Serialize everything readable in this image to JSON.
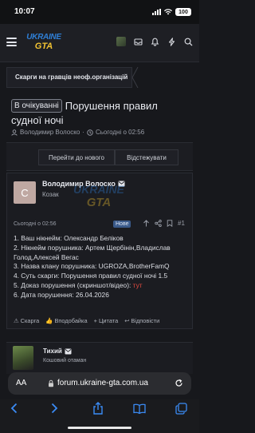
{
  "status": {
    "time": "10:07",
    "battery": "100"
  },
  "nav": {
    "logo_top": "UKRAINE",
    "logo_bottom": "GTA"
  },
  "breadcrumb": {
    "text": "Скарги на гравців неоф.організацій"
  },
  "thread": {
    "badge": "В очікуванні",
    "title_part1": "Порушення правил",
    "title_part2": "судної ночі",
    "author": "Володимир Волоско",
    "date": "Сьогодні о 02:56",
    "btn_new": "Перейти до нового",
    "btn_watch": "Відстежувати"
  },
  "post": {
    "avatar_letter": "С",
    "author": "Володимир Волоско",
    "role": "Козак",
    "date": "Сьогодні о 02:56",
    "new_badge": "Нове",
    "post_number": "#1",
    "watermark_top": "UKRAINE",
    "watermark_bottom": "GTA",
    "line1": "1. Ваш нікнейм: Олександр Беліков",
    "line2": "2. Нікнейм порушника: Артем Щербінін,Владислав Голод,Алексей Вегас",
    "line3": "3. Назва клану порушника: UGROZA,BrotherFamQ",
    "line4": "4. Суть скарги: Порушення правил судної ночі 1.5",
    "line5_prefix": "5. Доказ порушення (скриншот/відео):",
    "line5_link": "тут",
    "line6": "6. Дата порушення: 26.04.2026",
    "footer_report": "Скарга",
    "footer_like": "Вподобайка",
    "footer_quote": "+ Цитата",
    "footer_reply": "Відповісти"
  },
  "post2": {
    "author": "Тихий",
    "role": "Кошовий отаман"
  },
  "urlbar": {
    "aa": "AA",
    "url": "forum.ukraine-gta.com.ua"
  },
  "colors": {
    "background": "#17181c",
    "accent_blue": "#2f7fd6",
    "accent_yellow": "#f1c232",
    "link_red": "#e04a3f"
  }
}
